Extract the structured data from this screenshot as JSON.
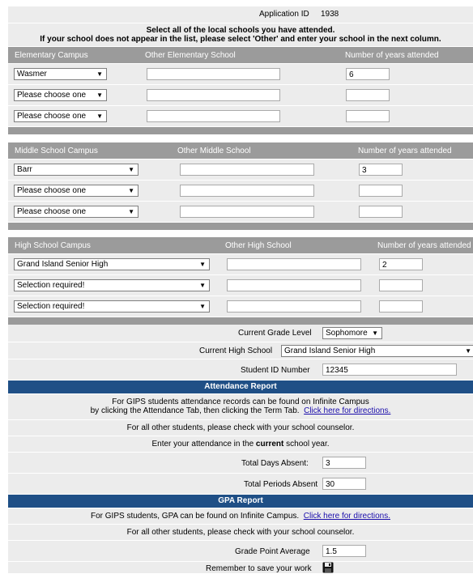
{
  "app_id": {
    "label": "Application ID",
    "value": "1938"
  },
  "instructions": {
    "line1": "Select all of the local schools you have attended.",
    "line2": "If your school does not appear in the list, please select 'Other' and enter your school in the next column."
  },
  "elementary": {
    "col_campus": "Elementary Campus",
    "col_other": "Other Elementary School",
    "col_years": "Number of years attended",
    "rows": [
      {
        "campus": "Wasmer",
        "other": "",
        "years": "6"
      },
      {
        "campus": "Please choose one",
        "other": "",
        "years": ""
      },
      {
        "campus": "Please choose one",
        "other": "",
        "years": ""
      }
    ]
  },
  "middle": {
    "col_campus": "Middle School Campus",
    "col_other": "Other Middle School",
    "col_years": "Number of years attended",
    "rows": [
      {
        "campus": "Barr",
        "other": "",
        "years": "3"
      },
      {
        "campus": "Please choose one",
        "other": "",
        "years": ""
      },
      {
        "campus": "Please choose one",
        "other": "",
        "years": ""
      }
    ]
  },
  "high": {
    "col_campus": "High School Campus",
    "col_other": "Other High School",
    "col_years": "Number of years attended",
    "rows": [
      {
        "campus": "Grand Island Senior High",
        "other": "",
        "years": "2"
      },
      {
        "campus": "Selection required!",
        "other": "",
        "years": ""
      },
      {
        "campus": "Selection required!",
        "other": "",
        "years": ""
      }
    ]
  },
  "current": {
    "grade_label": "Current Grade Level",
    "grade_value": "Sophomore",
    "hs_label": "Current High School",
    "hs_value": "Grand Island Senior High",
    "sid_label": "Student ID Number",
    "sid_value": "12345"
  },
  "attendance": {
    "title": "Attendance Report",
    "info1": "For GIPS students attendance records can be found on Infinite Campus",
    "info2": "by clicking the Attendance Tab, then clicking the Term Tab.",
    "link": "Click here for directions.",
    "counselor": "For all other students, please check with your school counselor.",
    "enter_pre": "Enter your attendance in the",
    "enter_bold": "current",
    "enter_post": "school year.",
    "days_label": "Total Days Absent:",
    "days_value": "3",
    "periods_label": "Total Periods Absent",
    "periods_value": "30"
  },
  "gpa": {
    "title": "GPA Report",
    "info": "For GIPS students, GPA can be found on Infinite Campus.",
    "link": "Click here for directions.",
    "counselor": "For all other students, please check with your school counselor.",
    "gpa_label": "Grade Point Average",
    "gpa_value": "1.5"
  },
  "footer": {
    "save_label": "Remember to save your work",
    "icon": "floppy-disk-icon"
  }
}
